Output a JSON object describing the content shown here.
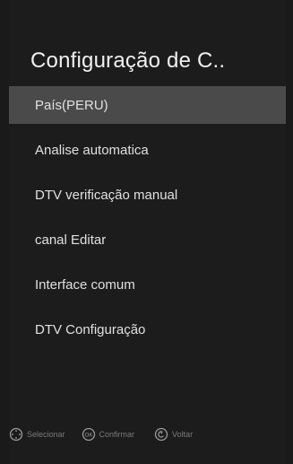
{
  "header": {
    "title": "Configuração de C.."
  },
  "menu": {
    "items": [
      {
        "label": "País(PERU)",
        "selected": true
      },
      {
        "label": "Analise automatica",
        "selected": false
      },
      {
        "label": "DTV verificação manual",
        "selected": false
      },
      {
        "label": "canal Editar",
        "selected": false
      },
      {
        "label": "Interface comum",
        "selected": false
      },
      {
        "label": "DTV Configuração",
        "selected": false
      }
    ]
  },
  "footer": {
    "hints": [
      {
        "icon": "dpad-icon",
        "label": "Selecionar"
      },
      {
        "icon": "ok-icon",
        "label": "Confirmar"
      },
      {
        "icon": "back-icon",
        "label": "Voltar"
      }
    ]
  },
  "colors": {
    "background": "#1c1c1c",
    "selected_row": "#4a4a4a",
    "text": "#e0e0e0"
  }
}
